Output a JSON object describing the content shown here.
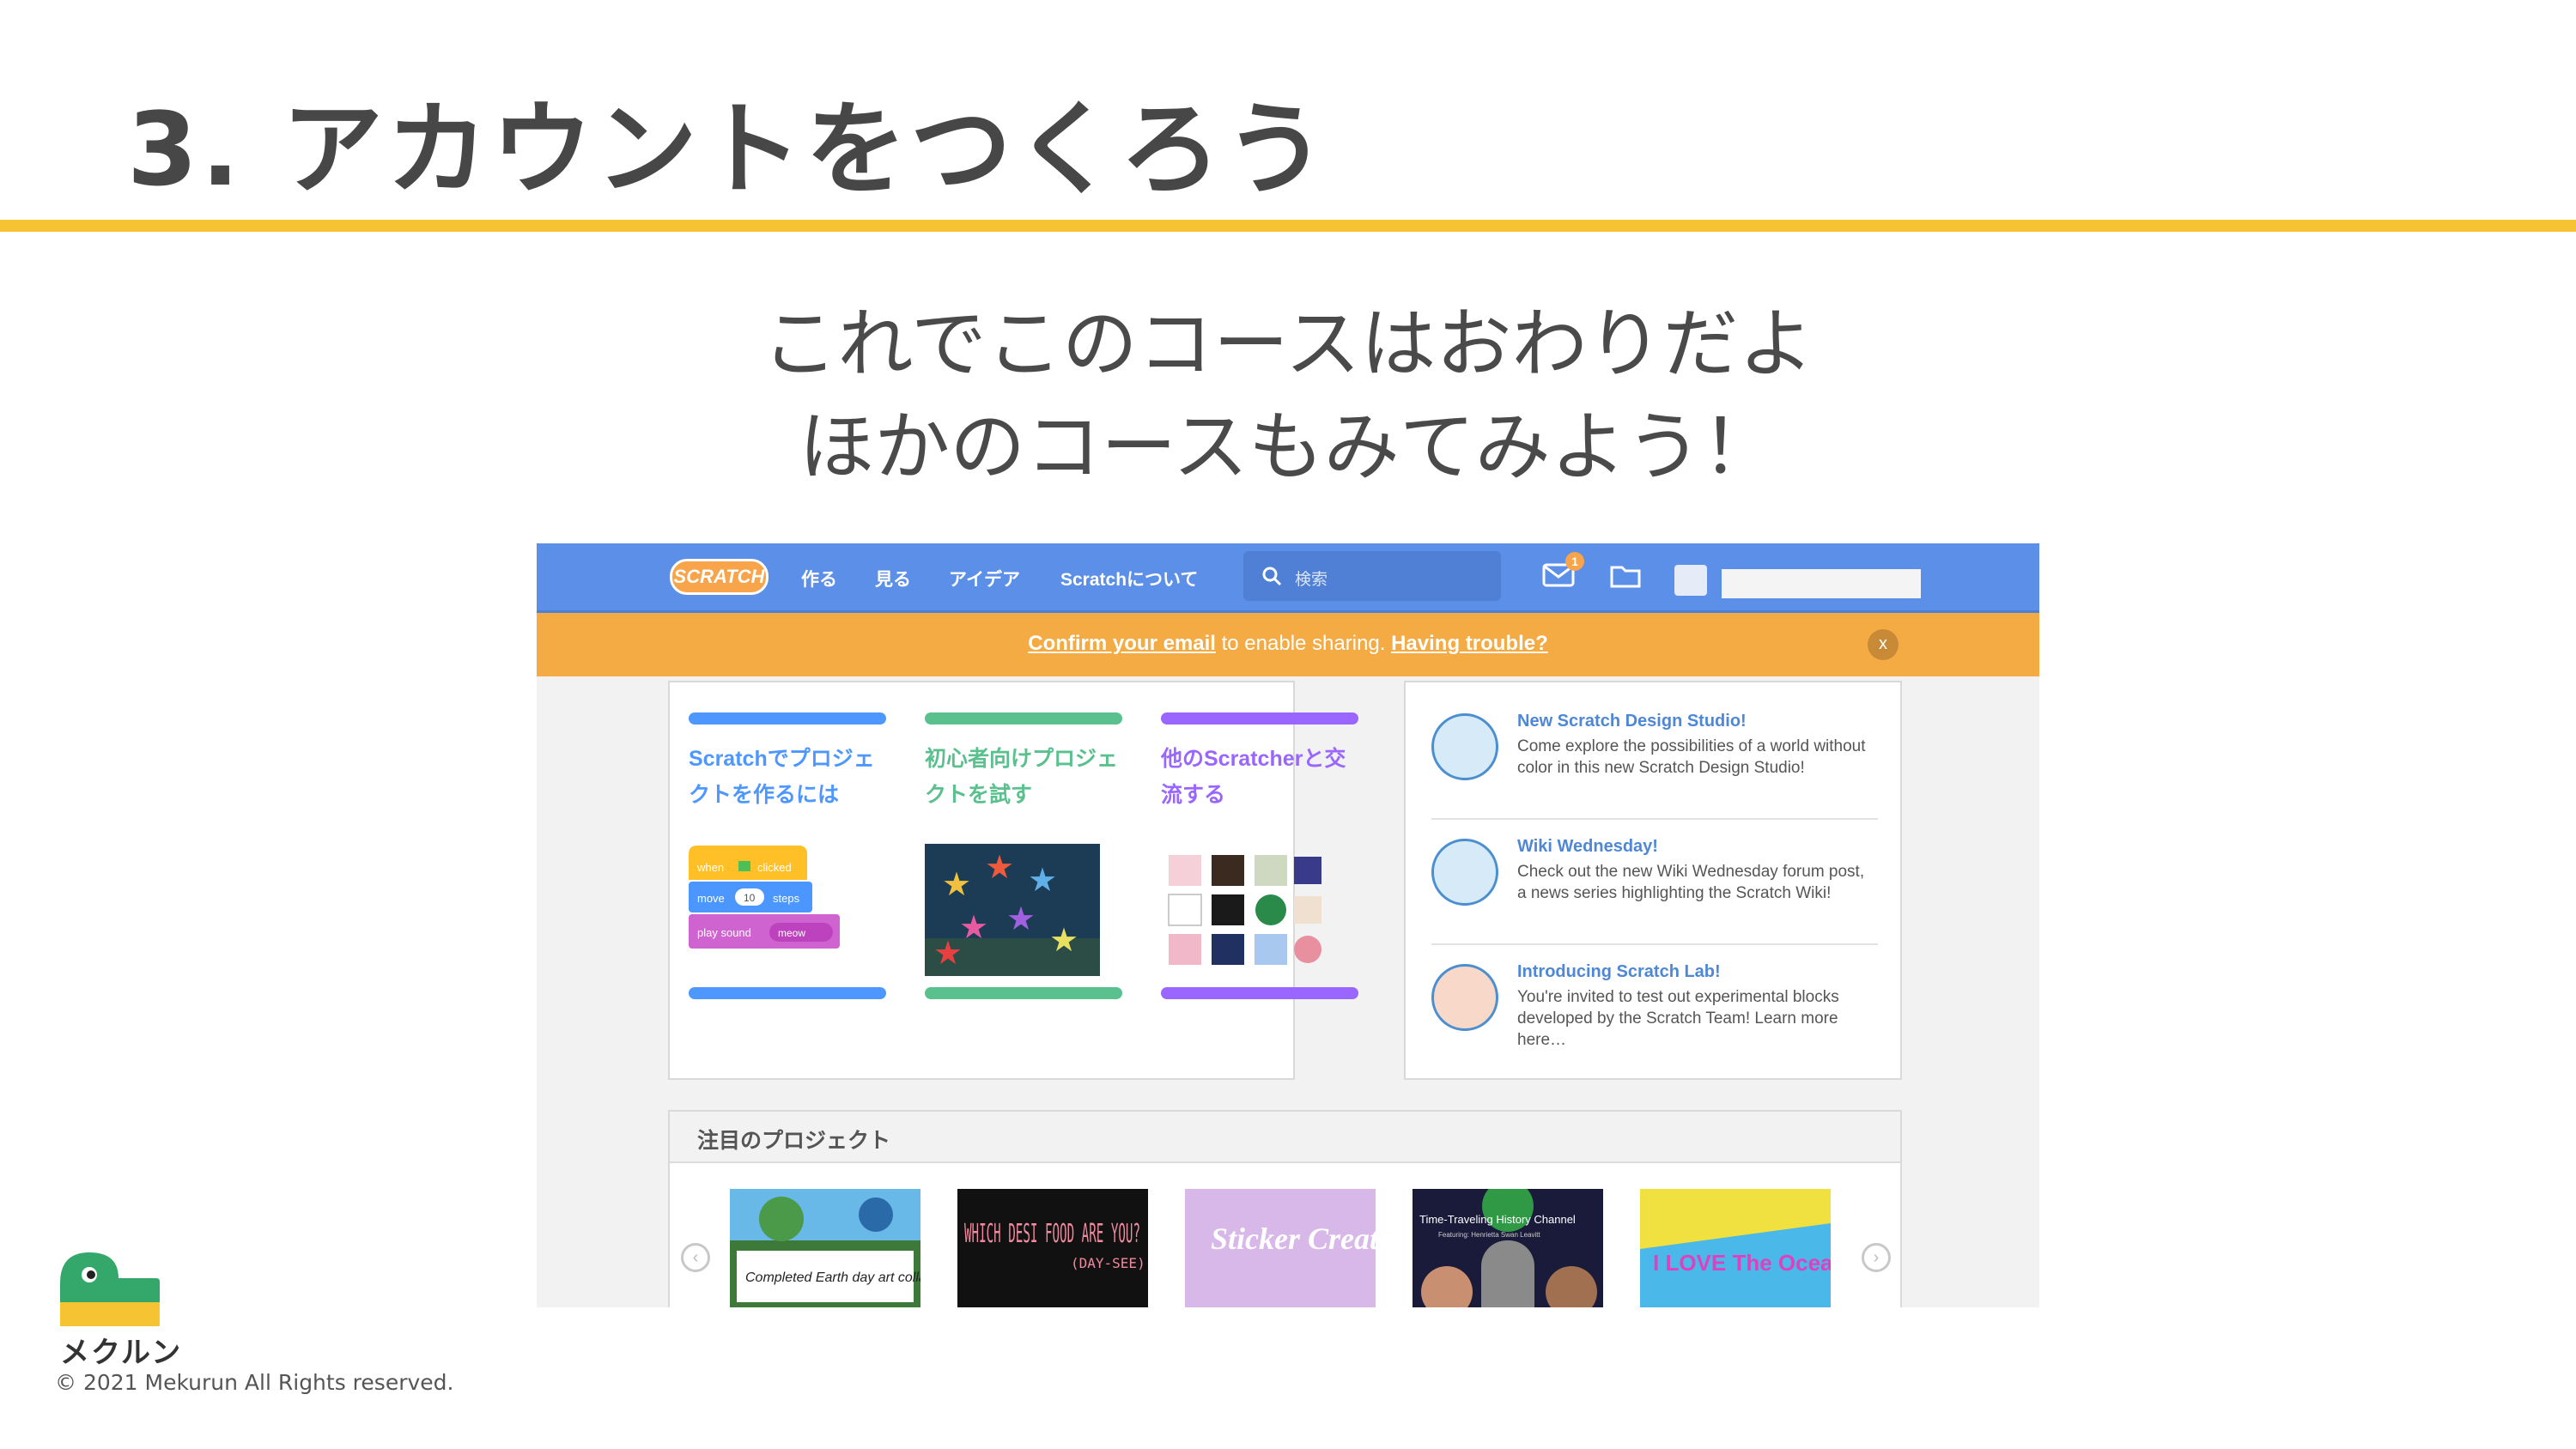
{
  "slide": {
    "title": "3. アカウントをつくろう",
    "line1": "これでこのコースはおわりだよ",
    "line2": "ほかのコースもみてみよう！",
    "accent_color": "#f6c333"
  },
  "scratch": {
    "logo": "SCRATCH",
    "nav": [
      "作る",
      "見る",
      "アイデア",
      "Scratchについて"
    ],
    "search_placeholder": "検索",
    "message_count": "1",
    "banner": {
      "confirm_link": "Confirm your email",
      "middle_text": " to enable sharing. ",
      "trouble_link": "Having trouble?",
      "close": "x"
    },
    "cards": [
      {
        "title": "Scratchでプロジェクトを作るには",
        "color": "#4d97ff",
        "icon": "code-blocks"
      },
      {
        "title": "初心者向けプロジェクトを試す",
        "color": "#59c08e",
        "icon": "starfish-game"
      },
      {
        "title": "他のScratcherと交流する",
        "color": "#9966ff",
        "icon": "community-avatars"
      }
    ],
    "blocks": {
      "when": "when",
      "clicked": "clicked",
      "move": "move",
      "steps_value": "10",
      "steps": "steps",
      "play_sound": "play sound",
      "meow": "meow"
    },
    "news": [
      {
        "title": "New Scratch Design Studio!",
        "body": "Come explore the possibilities of a world without color in this new Scratch Design Studio!",
        "icon": "paint-tools-icon"
      },
      {
        "title": "Wiki Wednesday!",
        "body": "Check out the new Wiki Wednesday forum post, a news series highlighting the Scratch Wiki!",
        "icon": "wiki-stack-icon"
      },
      {
        "title": "Introducing Scratch Lab!",
        "body": "You're invited to test out experimental blocks developed by the Scratch Team! Learn more here…",
        "icon": "scratch-cat-icon"
      }
    ],
    "featured_title": "注目のプロジェクト",
    "featured_projects": [
      {
        "label": "Completed Earth day art collab!"
      },
      {
        "label": "WHICH DESI FOOD ARE YOU?",
        "sub": "(DAY-SEE)"
      },
      {
        "label": "Sticker Creator"
      },
      {
        "label": "Time-Traveling History Channel",
        "sub": "Featuring: Henrietta Swan Leavitt"
      },
      {
        "label": "I LOVE The Ocean"
      }
    ]
  },
  "footer": {
    "brand": "メクルン",
    "copyright": "© 2021 Mekurun All Rights reserved."
  }
}
